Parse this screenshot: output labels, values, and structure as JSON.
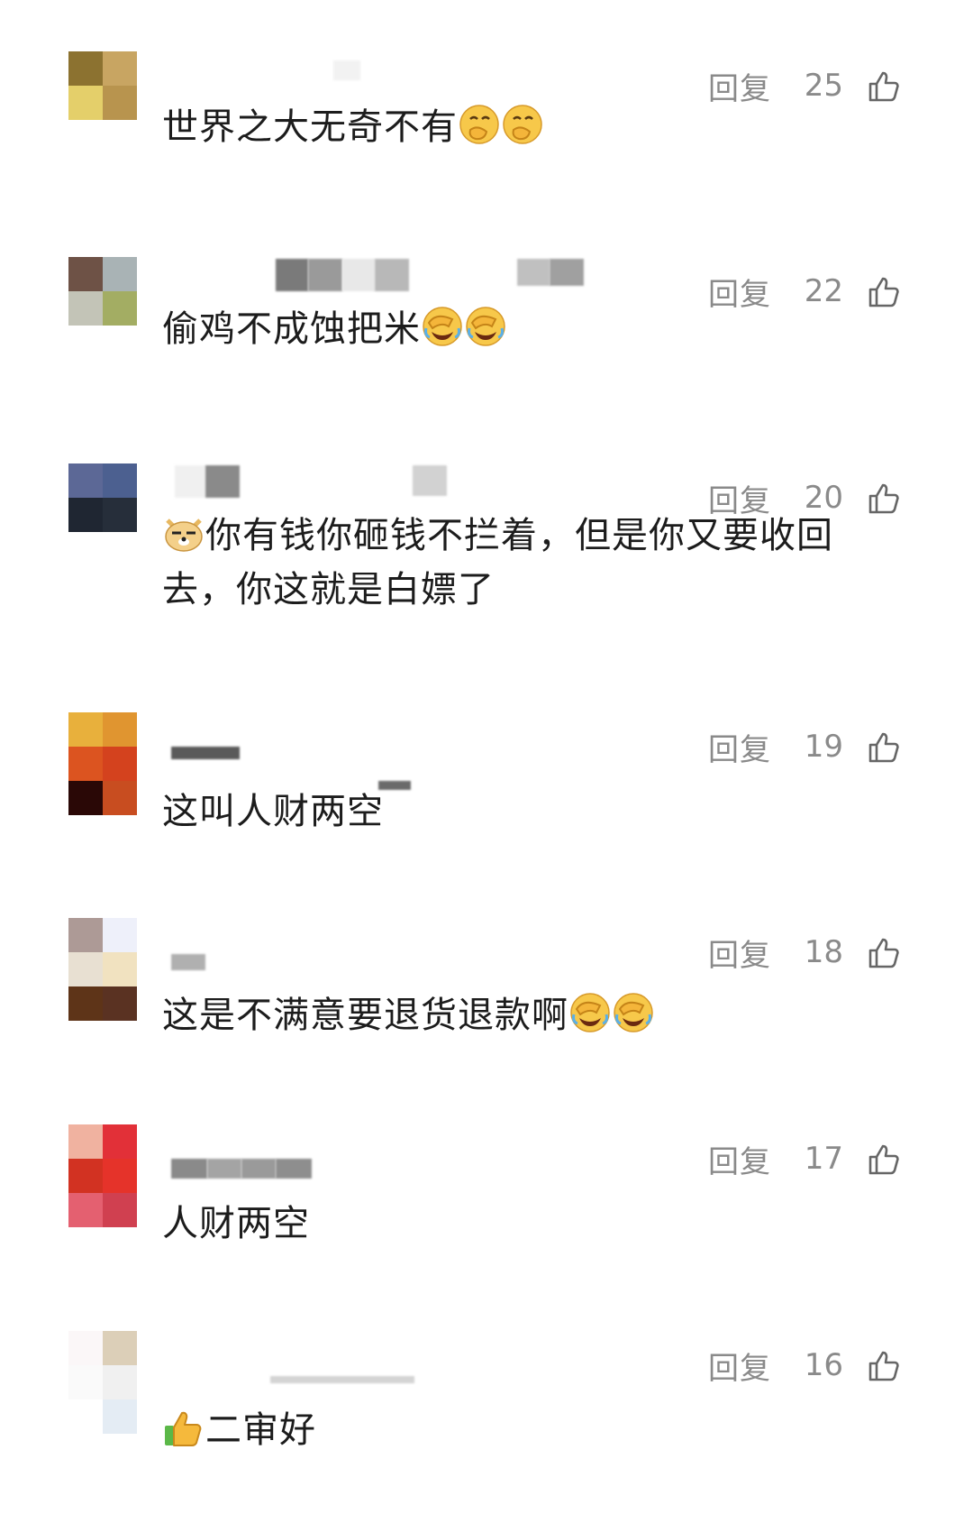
{
  "reply_label": "回复",
  "comments": [
    {
      "text": "世界之大无奇不有",
      "emoji_after": [
        "face-with-hand-over-mouth",
        "face-with-hand-over-mouth"
      ],
      "likes": "25",
      "avatar_colors": [
        "#8c7230",
        "#c8a562",
        "#e4cf6a",
        "#b8944e"
      ]
    },
    {
      "text": "偷鸡不成蚀把米",
      "emoji_after": [
        "facepalm-crying",
        "facepalm-crying"
      ],
      "likes": "22",
      "avatar_colors": [
        "#6e5246",
        "#a9b3b5",
        "#c3c4b7",
        "#a3ad63"
      ]
    },
    {
      "text_line1": "你有钱你砸钱不拦着，但是你又要收回",
      "text_line2": "去，你这就是白嫖了",
      "emoji_before": "doge",
      "likes": "20",
      "avatar_colors": [
        "#5c6896",
        "#4c6090",
        "#1f2632",
        "#262e3a"
      ]
    },
    {
      "text": "这叫人财两空",
      "likes": "19",
      "avatar_colors": [
        "#e8b03c",
        "#e09530",
        "#dc5420",
        "#d4421e",
        "#2a0806",
        "#c84d20"
      ]
    },
    {
      "text": "这是不满意要退货退款啊",
      "emoji_after": [
        "facepalm-crying",
        "facepalm-crying"
      ],
      "likes": "18",
      "avatar_colors": [
        "#ad9a96",
        "#eef0fa",
        "#e8e0d2",
        "#f1e2c0",
        "#5e3418",
        "#5a3222"
      ]
    },
    {
      "text": "人财两空",
      "likes": "17",
      "avatar_colors": [
        "#f0b2a0",
        "#e23038",
        "#d23222",
        "#e5332a",
        "#e46070",
        "#d04050"
      ]
    },
    {
      "text": "二审好",
      "emoji_before": "thumbs-up",
      "likes": "16",
      "avatar_colors": [
        "#fbf7f8",
        "#dccfb8",
        "#fafafa",
        "#f0f0f0",
        "#ffffff",
        "#e4ecf4"
      ]
    }
  ]
}
